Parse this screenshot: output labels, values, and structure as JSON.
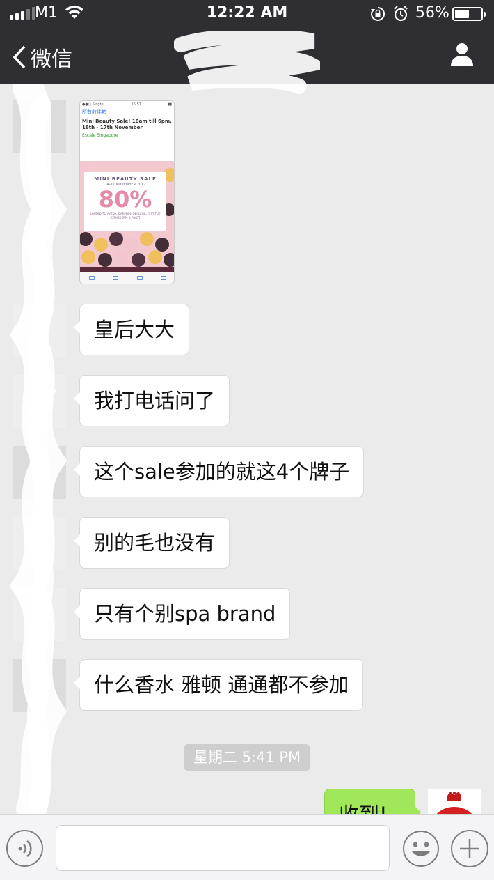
{
  "status_bar": {
    "carrier": "M1",
    "time": "12:22 AM",
    "battery_percent": "56%",
    "battery_level": 0.56
  },
  "nav": {
    "back_label": "微信",
    "back_icon": "chevron-left-icon",
    "profile_icon": "person-icon"
  },
  "messages": [
    {
      "type": "image",
      "caption": "email screenshot"
    },
    {
      "type": "text",
      "text": "皇后大大"
    },
    {
      "type": "text",
      "text": "我打电话问了"
    },
    {
      "type": "text",
      "text": "这个sale参加的就这4个牌子"
    },
    {
      "type": "text",
      "text": "别的毛也没有"
    },
    {
      "type": "text",
      "text": "只有个别spa brand"
    },
    {
      "type": "text",
      "text": "什么香水 雅顿 通通都不参加"
    }
  ],
  "image_message": {
    "folder": "所有收件箱",
    "subject": "Mini Beauty Sale! 10am till 6pm, 16th - 17th November",
    "sender": "Escale Singapore",
    "banner_title": "MINI BEAUTY SALE",
    "banner_dates": "14-17 NOVEMBER 2017",
    "banner_discount": "80%",
    "banner_note": "LIMITED TO AVEDA, DARPHIN, DECLEOR, INSTITUT ESTHEDERM & PAYOT"
  },
  "timestamp": "星期二 5:41 PM",
  "my_message": "收到!",
  "input_bar": {
    "voice_icon": "voice-icon",
    "emoji_icon": "emoji-icon",
    "plus_icon": "plus-icon"
  },
  "colors": {
    "nav_bg": "#2e2e33",
    "chat_bg": "#ebebeb",
    "my_bubble": "#a0e759",
    "timestamp_bg": "#cecece"
  }
}
